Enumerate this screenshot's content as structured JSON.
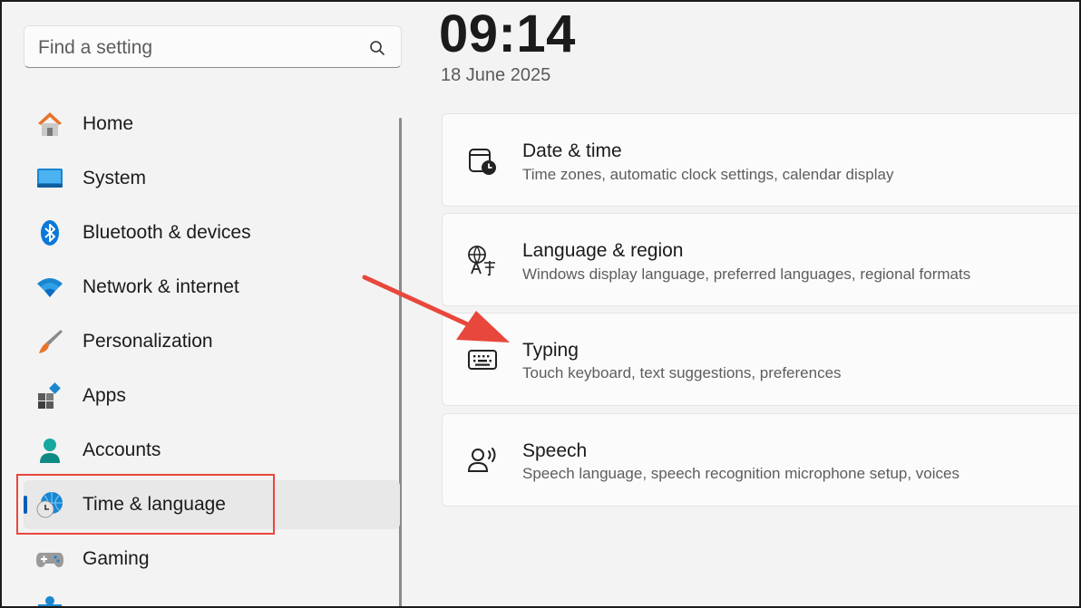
{
  "search": {
    "placeholder": "Find a setting"
  },
  "sidebar": {
    "items": [
      {
        "label": "Home",
        "icon": "home-icon"
      },
      {
        "label": "System",
        "icon": "system-icon"
      },
      {
        "label": "Bluetooth & devices",
        "icon": "bluetooth-icon"
      },
      {
        "label": "Network & internet",
        "icon": "wifi-icon"
      },
      {
        "label": "Personalization",
        "icon": "brush-icon"
      },
      {
        "label": "Apps",
        "icon": "apps-icon"
      },
      {
        "label": "Accounts",
        "icon": "accounts-icon"
      },
      {
        "label": "Time & language",
        "icon": "time-language-icon",
        "selected": true
      },
      {
        "label": "Gaming",
        "icon": "gamepad-icon"
      }
    ]
  },
  "header": {
    "time": "09:14",
    "date": "18 June 2025"
  },
  "cards": [
    {
      "title": "Date & time",
      "description": "Time zones, automatic clock settings, calendar display",
      "icon": "calendar-clock-icon"
    },
    {
      "title": "Language & region",
      "description": "Windows display language, preferred languages, regional formats",
      "icon": "language-icon"
    },
    {
      "title": "Typing",
      "description": "Touch keyboard, text suggestions, preferences",
      "icon": "keyboard-icon"
    },
    {
      "title": "Speech",
      "description": "Speech language, speech recognition microphone setup, voices",
      "icon": "speech-icon"
    }
  ],
  "colors": {
    "accent": "#005fb8",
    "annotation": "#e8473b"
  }
}
